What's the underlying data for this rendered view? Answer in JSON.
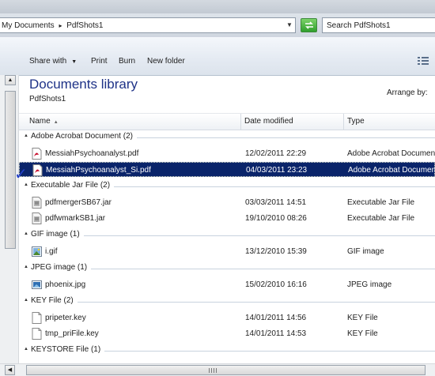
{
  "address": {
    "crumbs": [
      "My Documents",
      "PdfShots1"
    ],
    "separator": "▸"
  },
  "search": {
    "placeholder": "Search PdfShots1"
  },
  "toolbar": {
    "share_with": "Share with",
    "print": "Print",
    "burn": "Burn",
    "new_folder": "New folder"
  },
  "library": {
    "title": "Documents library",
    "subtitle": "PdfShots1",
    "arrange_by": "Arrange by:"
  },
  "columns": {
    "name": "Name",
    "date": "Date modified",
    "type": "Type"
  },
  "groups": [
    {
      "label": "Adobe Acrobat Document (2)",
      "files": [
        {
          "name": "MessiahPsychoanalyst.pdf",
          "date": "12/02/2011 22:29",
          "type": "Adobe Acrobat Document",
          "icon": "pdf-icon",
          "selected": false
        },
        {
          "name": "MessiahPsychoanalyst_Si.pdf",
          "date": "04/03/2011 23:23",
          "type": "Adobe Acrobat Document",
          "icon": "pdf-icon",
          "selected": true
        }
      ]
    },
    {
      "label": "Executable Jar File (2)",
      "files": [
        {
          "name": "pdfmergerSB67.jar",
          "date": "03/03/2011 14:51",
          "type": "Executable Jar File",
          "icon": "jar-icon",
          "selected": false
        },
        {
          "name": "pdfwmarkSB1.jar",
          "date": "19/10/2010 08:26",
          "type": "Executable Jar File",
          "icon": "jar-icon",
          "selected": false
        }
      ]
    },
    {
      "label": "GIF image (1)",
      "files": [
        {
          "name": "i.gif",
          "date": "13/12/2010 15:39",
          "type": "GIF image",
          "icon": "gif-image-icon",
          "selected": false
        }
      ]
    },
    {
      "label": "JPEG image (1)",
      "files": [
        {
          "name": "phoenix.jpg",
          "date": "15/02/2010 16:16",
          "type": "JPEG image",
          "icon": "jpeg-image-icon",
          "selected": false
        }
      ]
    },
    {
      "label": "KEY File (2)",
      "files": [
        {
          "name": "pripeter.key",
          "date": "14/01/2011 14:56",
          "type": "KEY File",
          "icon": "file-icon",
          "selected": false
        },
        {
          "name": "tmp_priFile.key",
          "date": "14/01/2011 14:53",
          "type": "KEY File",
          "icon": "file-icon",
          "selected": false
        }
      ]
    },
    {
      "label": "KEYSTORE File (1)",
      "files": []
    }
  ],
  "colors": {
    "selection": "#0a246a",
    "library_title": "#1e3287",
    "annotation_check": "#2340c8"
  }
}
